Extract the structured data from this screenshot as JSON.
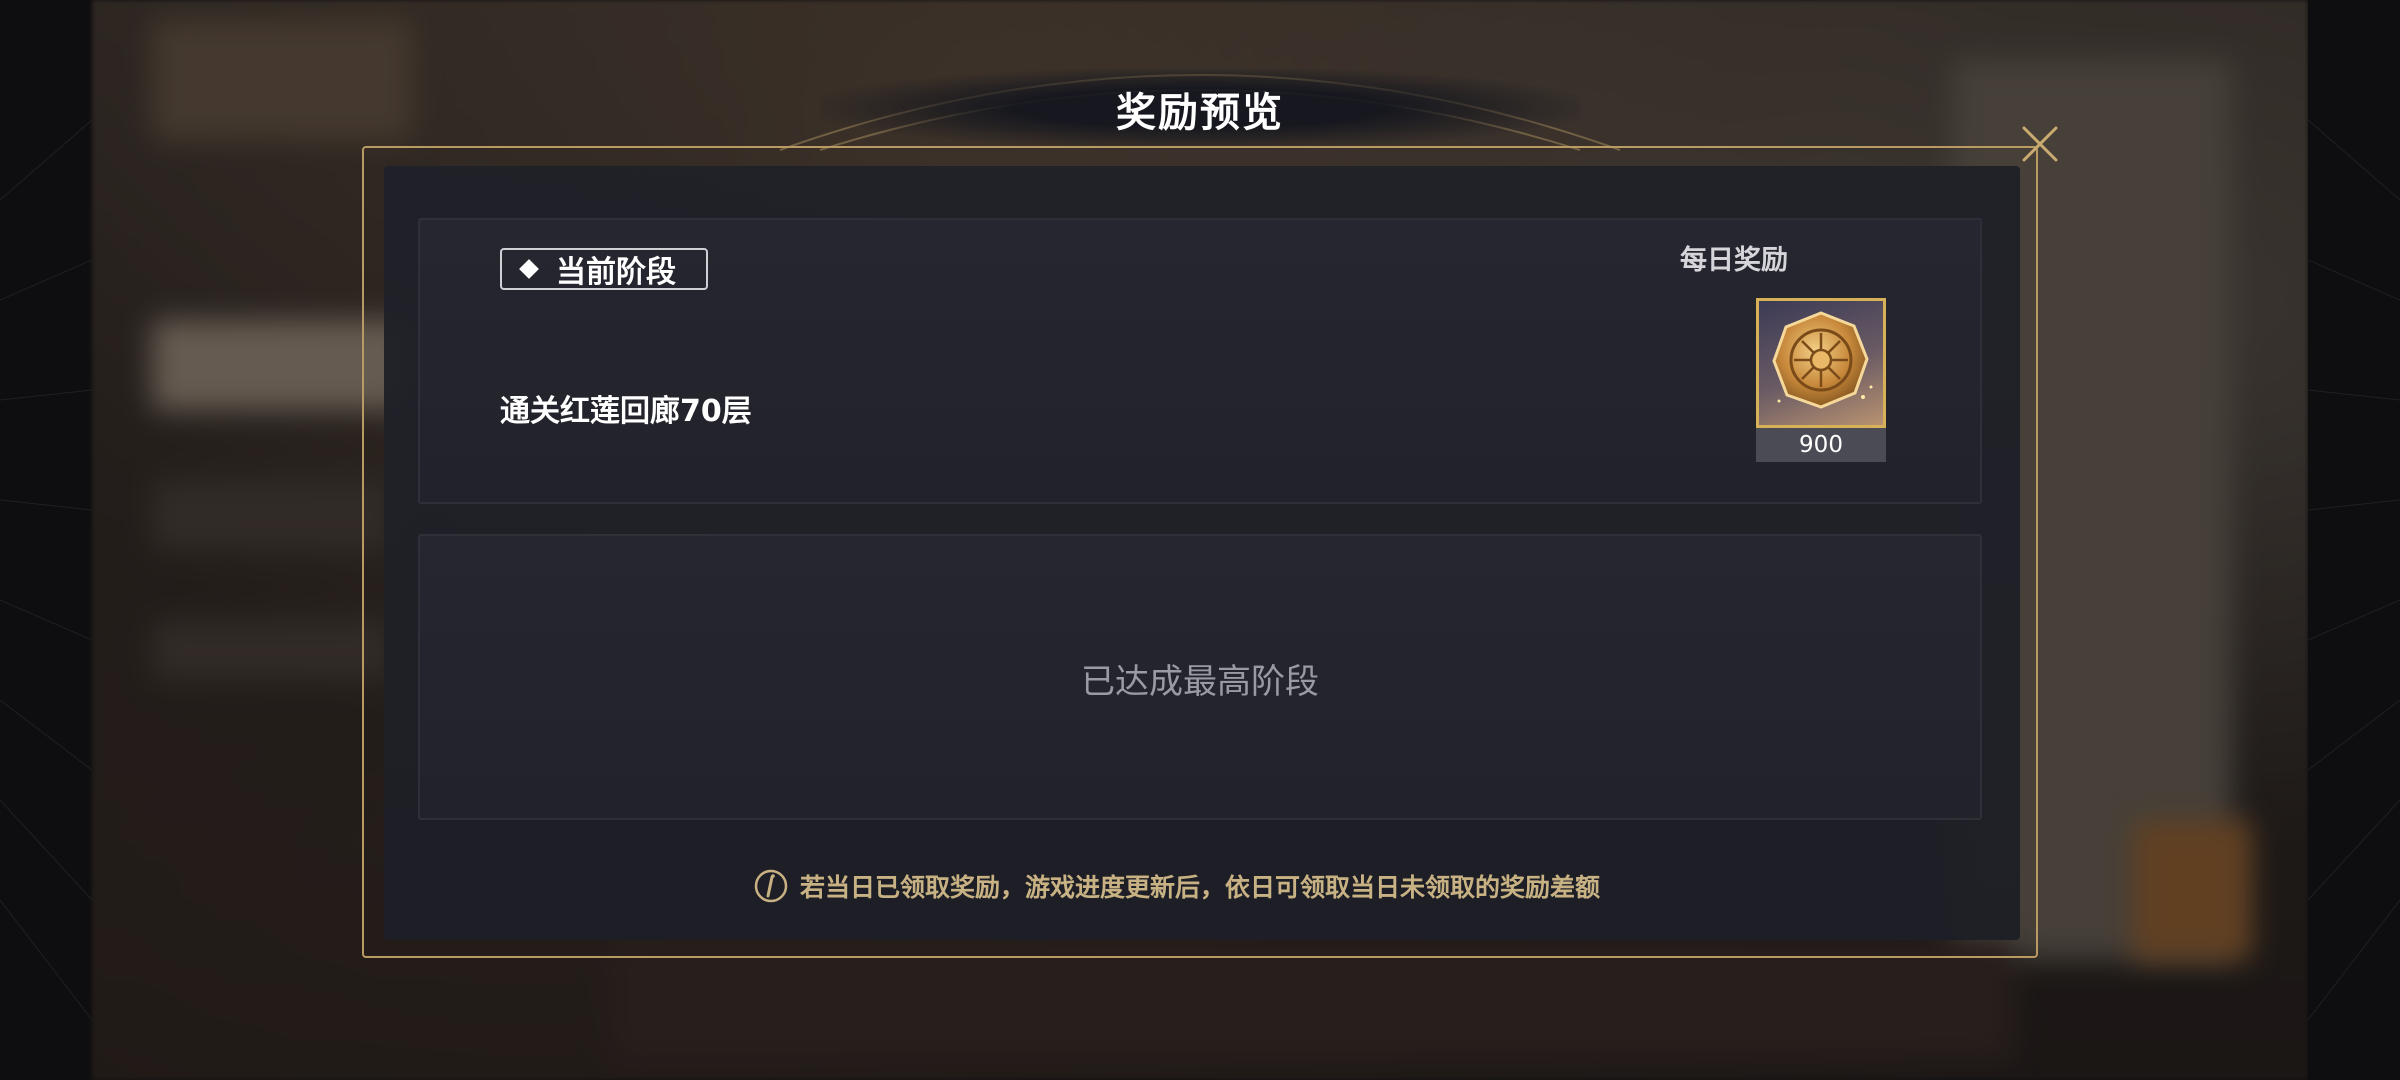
{
  "dialog": {
    "title": "奖励预览",
    "close_icon": "close-icon"
  },
  "current_stage": {
    "tag_label": "当前阶段",
    "tag_icon": "diamond-icon",
    "description": "通关红莲回廊70层",
    "daily_reward_label": "每日奖励",
    "reward": {
      "icon": "gold-medal-icon",
      "quantity": "900"
    }
  },
  "next_stage": {
    "message": "已达成最高阶段"
  },
  "notice": {
    "icon": "info-icon",
    "text": "若当日已领取奖励，游戏进度更新后，依日可领取当日未领取的奖励差额"
  },
  "colors": {
    "frame_gold": "#b89a62",
    "notice_text": "#c8b284",
    "reward_border": "#d7b158"
  }
}
